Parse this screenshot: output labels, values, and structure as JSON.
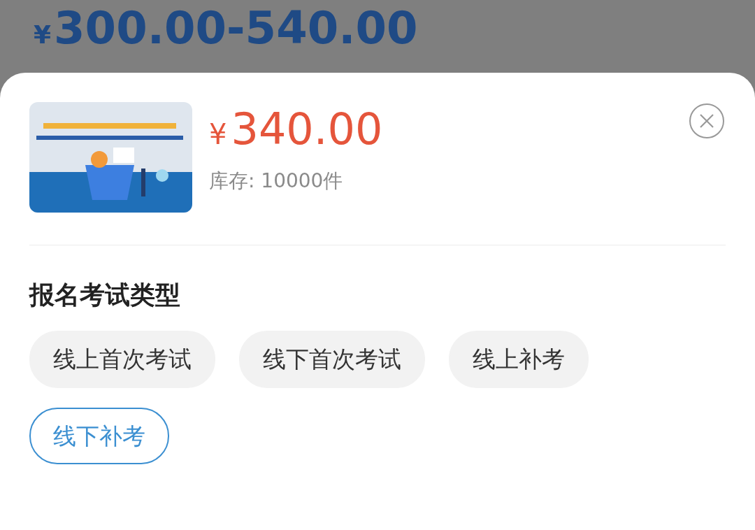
{
  "backdrop": {
    "currency": "¥",
    "price_range": "300.00-540.00"
  },
  "product": {
    "currency": "¥",
    "price": "340.00",
    "stock": "库存: 10000件"
  },
  "section": {
    "title": "报名考试类型"
  },
  "options": [
    {
      "label": "线上首次考试",
      "selected": false
    },
    {
      "label": "线下首次考试",
      "selected": false
    },
    {
      "label": "线上补考",
      "selected": false
    },
    {
      "label": "线下补考",
      "selected": true
    }
  ]
}
